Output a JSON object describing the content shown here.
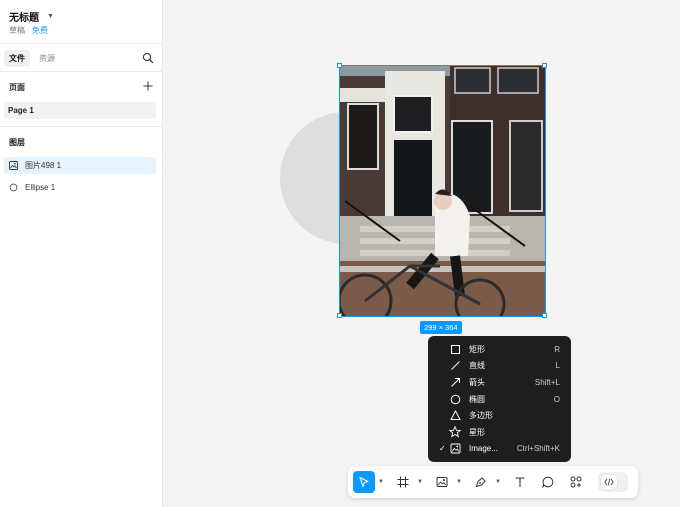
{
  "file": {
    "title": "无标题",
    "draft": "草稿",
    "plan": "免费"
  },
  "tabs": [
    {
      "label": "文件"
    },
    {
      "label": "资源"
    }
  ],
  "pages": {
    "title": "页面",
    "items": [
      {
        "label": "Page 1"
      }
    ]
  },
  "layers": {
    "title": "图层",
    "items": [
      {
        "label": "图片498 1"
      },
      {
        "label": "Ellipse 1"
      }
    ]
  },
  "selection": {
    "size_label": "299 × 364"
  },
  "menu": {
    "items": [
      {
        "label": "矩形",
        "shortcut": "R",
        "icon": "rectangle-icon",
        "checked": ""
      },
      {
        "label": "直线",
        "shortcut": "L",
        "icon": "line-icon",
        "checked": ""
      },
      {
        "label": "箭头",
        "shortcut": "Shift+L",
        "icon": "arrow-icon",
        "checked": ""
      },
      {
        "label": "椭圆",
        "shortcut": "O",
        "icon": "ellipse-icon",
        "checked": ""
      },
      {
        "label": "多边形",
        "shortcut": "",
        "icon": "polygon-icon",
        "checked": ""
      },
      {
        "label": "星形",
        "shortcut": "",
        "icon": "star-icon",
        "checked": ""
      },
      {
        "label": "Image...",
        "shortcut": "Ctrl+Shift+K",
        "icon": "image-icon",
        "checked": "✓"
      }
    ]
  },
  "colors": {
    "accent": "#0d99ff",
    "menu_bg": "#1e1e1e",
    "circle": "#dedede"
  }
}
